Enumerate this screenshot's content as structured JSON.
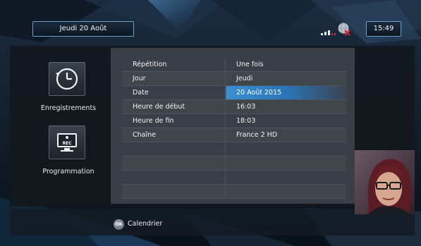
{
  "header": {
    "date": "Jeudi 20 Août",
    "time": "15:49",
    "signal_icon": "signal-bars-icon",
    "network_icon": "network-globe-icon"
  },
  "sidebar": {
    "items": [
      {
        "label": "Enregistrements",
        "icon": "clock-history-icon"
      },
      {
        "label": "Programmation",
        "icon": "rec-tv-icon",
        "icon_text": "REC"
      }
    ]
  },
  "schedule": {
    "rows": [
      {
        "label": "Répétition",
        "value": "Une fois"
      },
      {
        "label": "Jour",
        "value": "Jeudi"
      },
      {
        "label": "Date",
        "value": "20 Août 2015",
        "selected": true
      },
      {
        "label": "Heure de début",
        "value": "16:03"
      },
      {
        "label": "Heure de fin",
        "value": "18:03"
      },
      {
        "label": "Chaîne",
        "value": "France 2 HD"
      },
      {
        "label": "",
        "value": ""
      },
      {
        "label": "",
        "value": ""
      },
      {
        "label": "",
        "value": ""
      },
      {
        "label": "",
        "value": ""
      }
    ]
  },
  "footer": {
    "ok_button": "OK",
    "ok_label": "Calendrier"
  },
  "colors": {
    "accent": "#2a7bc0",
    "frame": "#6ea0cc"
  }
}
